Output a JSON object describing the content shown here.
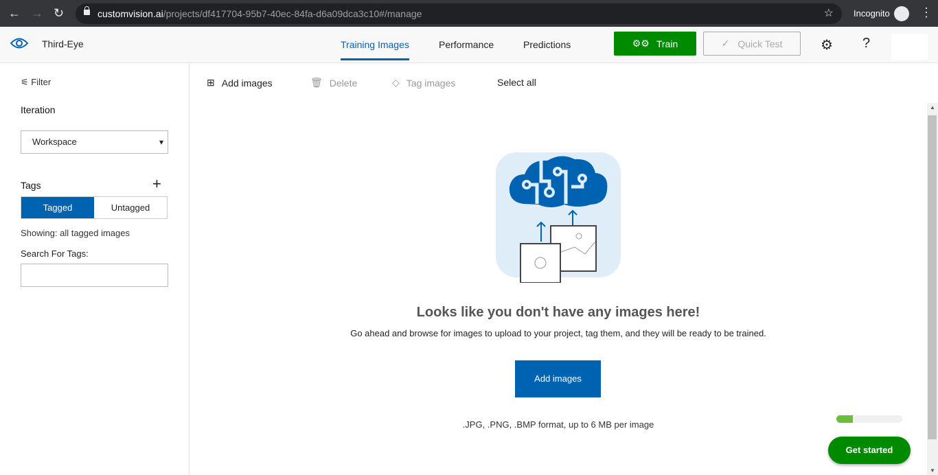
{
  "browser": {
    "url_host": "customvision.ai",
    "url_path": "/projects/df417704-95b7-40ec-84fa-d6a09dca3c10#/manage",
    "incognito_label": "Incognito"
  },
  "header": {
    "project": "Third-Eye",
    "tabs": [
      {
        "label": "Training Images",
        "active": true
      },
      {
        "label": "Performance"
      },
      {
        "label": "Predictions"
      }
    ],
    "train_label": "Train",
    "quick_test_label": "Quick Test",
    "help": "?"
  },
  "sidebar": {
    "filter": "Filter",
    "iteration_label": "Iteration",
    "iteration_value": "Workspace",
    "tags_label": "Tags",
    "tagged": "Tagged",
    "untagged": "Untagged",
    "showing": "Showing: all tagged images",
    "search_label": "Search For Tags:",
    "search_value": ""
  },
  "toolbar": {
    "add": "Add images",
    "delete": "Delete",
    "tag": "Tag images",
    "select_all": "Select all"
  },
  "empty": {
    "headline": "Looks like you don't have any images here!",
    "sub": "Go ahead and browse for images to upload to your project, tag them, and they will be ready to be trained.",
    "button": "Add images",
    "format": ".JPG, .PNG, .BMP format, up to 6 MB per image"
  },
  "onboarding": {
    "progress_percent": 25,
    "button": "Get started"
  },
  "colors": {
    "accent": "#0063b1",
    "green": "#008a00"
  }
}
